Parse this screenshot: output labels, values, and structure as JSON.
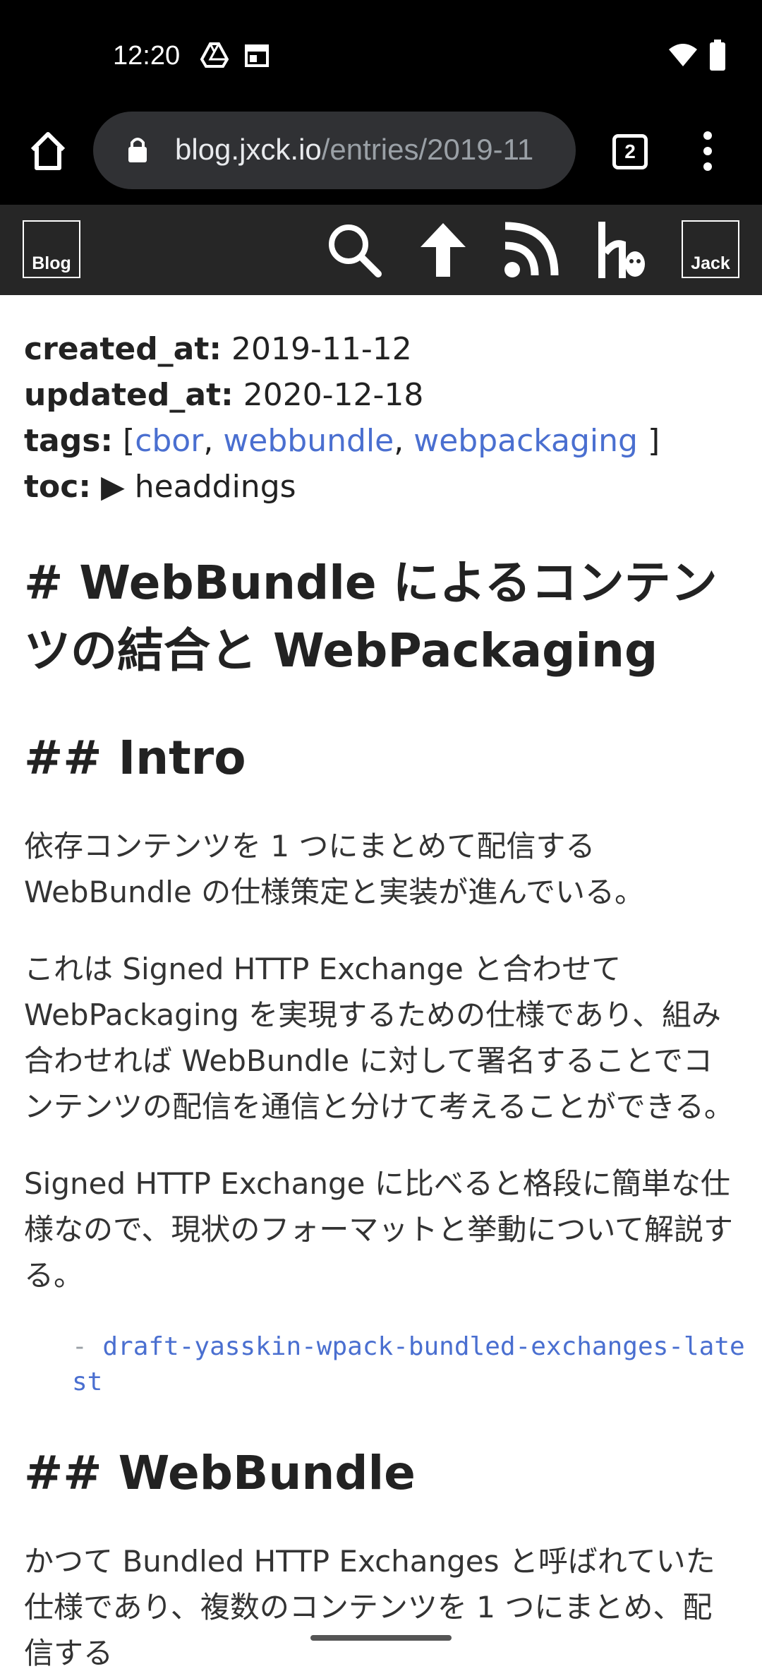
{
  "status_bar": {
    "time": "12:20"
  },
  "browser": {
    "url_host": "blog.jxck.io",
    "url_path": "/entries/2019-11",
    "tab_count": "2"
  },
  "site_header": {
    "blog_logo": "Blog",
    "jack_logo": "Jack",
    "icons": [
      "search-icon",
      "up-arrow-icon",
      "rss-icon",
      "hatena-icon"
    ]
  },
  "meta": {
    "created_key": "created_at:",
    "created_value": "2019-11-12",
    "updated_key": "updated_at:",
    "updated_value": "2020-12-18",
    "tags_key": "tags:",
    "tags_open": "[",
    "tags_close": "]",
    "tags": [
      "cbor",
      "webbundle",
      "webpackaging"
    ],
    "toc_key": "toc:",
    "toc_value": "headdings"
  },
  "article": {
    "title": "# WebBundle によるコンテンツの結合と WebPackaging",
    "h2_intro": "## Intro",
    "para1": "依存コンテンツを 1 つにまとめて配信する WebBundle の仕様策定と実装が進んでいる。",
    "para2": "これは Signed HTTP Exchange と合わせて WebPackaging を実現するための仕様であり、組み合わせれば WebBundle に対して署名することでコンテンツの配信を通信と分けて考えることができる。",
    "para3": "Signed HTTP Exchange に比べると格段に簡単な仕様なので、現状のフォーマットと挙動について解説する。",
    "spec_dash": "- ",
    "spec_link": "draft-yasskin-wpack-bundled-exchanges-latest",
    "h2_webbundle": "## WebBundle",
    "para4": "かつて Bundled HTTP Exchanges と呼ばれていた仕様であり、複数のコンテンツを 1 つにまとめ、配信する"
  }
}
